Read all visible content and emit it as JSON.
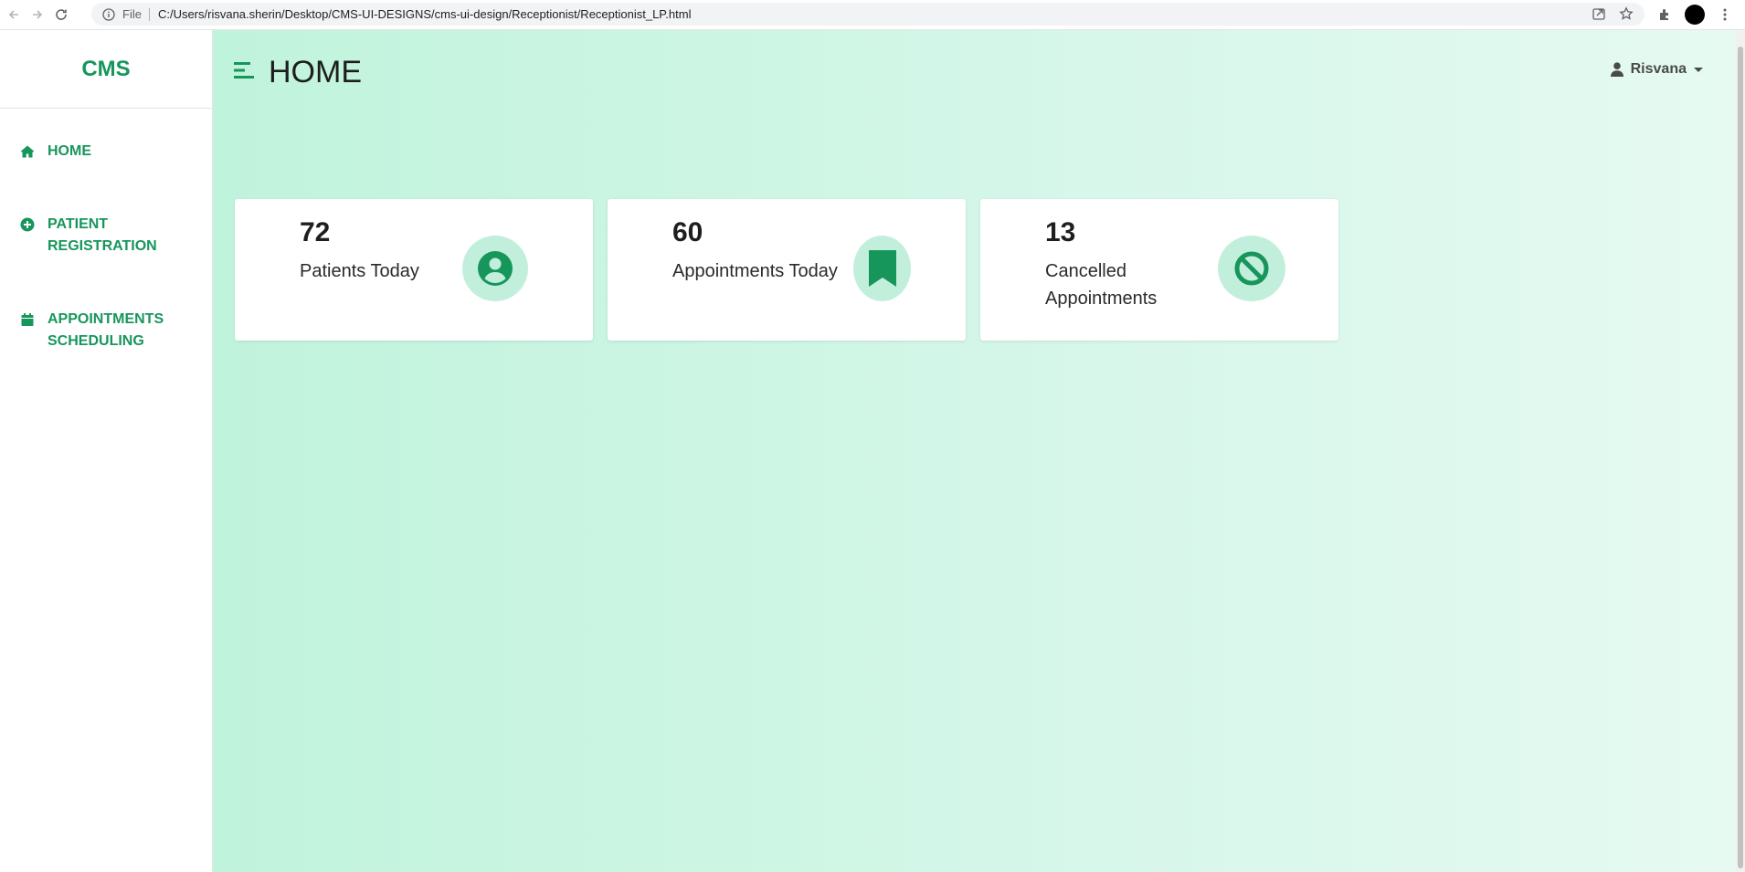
{
  "browser": {
    "file_label": "File",
    "url": "C:/Users/risvana.sherin/Desktop/CMS-UI-DESIGNS/cms-ui-design/Receptionist/Receptionist_LP.html"
  },
  "sidebar": {
    "brand": "CMS",
    "items": [
      {
        "label": "HOME",
        "icon": "home-icon"
      },
      {
        "label": "PATIENT REGISTRATION",
        "icon": "plus-circle-icon"
      },
      {
        "label": "APPOINTMENTS SCHEDULING",
        "icon": "calendar-icon"
      }
    ]
  },
  "header": {
    "title": "HOME",
    "user_name": "Risvana"
  },
  "stats": [
    {
      "value": "72",
      "label": "Patients Today",
      "icon": "user-circle-icon"
    },
    {
      "value": "60",
      "label": "Appointments Today",
      "icon": "bookmark-icon"
    },
    {
      "value": "13",
      "label": "Cancelled Appointments",
      "icon": "ban-icon"
    }
  ],
  "colors": {
    "accent": "#17965c",
    "icon_bg": "#c2efdb",
    "main_bg_start": "#c0f3dc",
    "main_bg_end": "#e6faf1"
  }
}
